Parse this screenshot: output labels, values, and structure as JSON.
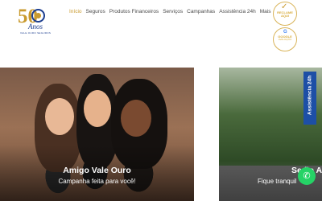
{
  "logo": {
    "number": "50",
    "word": "Anos",
    "tagline": "VALE OURO SEGUROS"
  },
  "nav": {
    "items": [
      "Início",
      "Seguros",
      "Produtos Financeiros",
      "Serviços",
      "Campanhas",
      "Assistência 24h",
      "Mais"
    ],
    "active": "Início"
  },
  "badges": {
    "reclame": {
      "line1": "RECLAME AQUI",
      "line2": ""
    },
    "google": {
      "line1": "GOOGLE",
      "line2": "AVALIAÇÃO"
    }
  },
  "cards": [
    {
      "title": "Amigo Vale Ouro",
      "subtitle": "Campanha feita para você!"
    },
    {
      "title": "Se ão A",
      "subtitle": "Fique tranquil"
    }
  ],
  "side_tab": {
    "label": "Assistência 24h"
  },
  "colors": {
    "accent": "#c99a2e",
    "brand": "#1d3f8f",
    "tab": "#1d4fa6",
    "whatsapp": "#25d366"
  },
  "icons": {
    "whatsapp": "whatsapp-icon",
    "check": "check-icon"
  }
}
